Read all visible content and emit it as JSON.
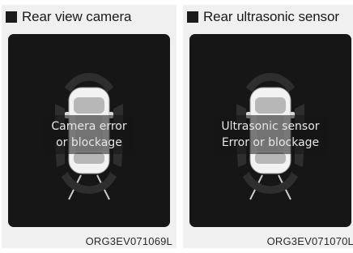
{
  "panels": [
    {
      "title": "Rear view camera",
      "message_line1": "Camera error",
      "message_line2": "or blockage",
      "code": "ORG3EV071069L"
    },
    {
      "title": "Rear ultrasonic sensor",
      "message_line1": "Ultrasonic sensor",
      "message_line2": "Error or blockage",
      "code": "ORG3EV071070L"
    }
  ],
  "colors": {
    "panel_bg": "#f0f0f0",
    "screen_bg": "#161616",
    "message_text": "#e6e6e6"
  },
  "icons": [
    "vehicle-top-view-icon",
    "rear-sensor-arc-icon",
    "rear-guideline-icon"
  ]
}
